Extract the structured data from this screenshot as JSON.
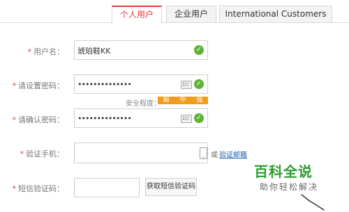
{
  "tabs": [
    {
      "label": "个人用户",
      "active": true
    },
    {
      "label": "企业用户",
      "active": false
    },
    {
      "label": "International Customers",
      "active": false
    }
  ],
  "form": {
    "required_mark": "*",
    "username": {
      "label": "用户名：",
      "value": "琥珀鞋KK"
    },
    "password": {
      "label": "请设置密码：",
      "value": "••••••••••••••"
    },
    "strength": {
      "label": "安全程度：",
      "levels": [
        "弱",
        "中",
        "强"
      ]
    },
    "confirm": {
      "label": "请确认密码：",
      "value": "••••••••••••••"
    },
    "phone": {
      "label": "验证手机：",
      "value": "",
      "or_text": "或",
      "email_link": "验证邮箱"
    },
    "sms": {
      "label": "短信验证码：",
      "value": "",
      "button": "获取短信验证码"
    }
  },
  "watermark": {
    "title": "百科全说",
    "subtitle": "助你轻松解决"
  },
  "icons": {
    "ok": "check-circle-icon",
    "keyboard": "keyboard-icon",
    "phone": "phone-icon"
  },
  "colors": {
    "accent": "#e4393c",
    "ok": "#5fb336",
    "strength": "#f29c1f",
    "link": "#1a5fb4",
    "watermark": "#2e9b2e"
  }
}
